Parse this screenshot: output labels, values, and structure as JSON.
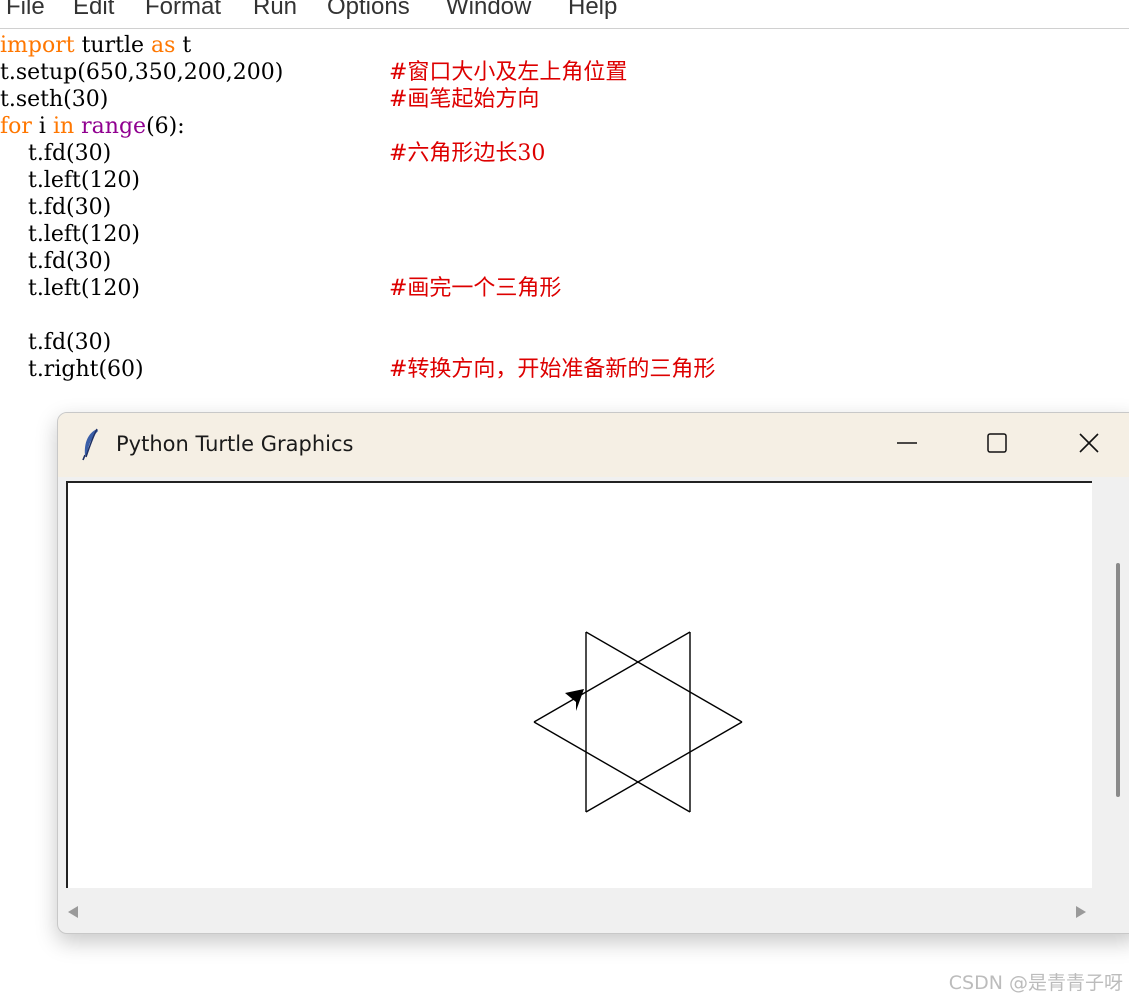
{
  "menu": [
    "File",
    "Edit",
    "Format",
    "Run",
    "Options",
    "Window",
    "Help"
  ],
  "code": [
    {
      "tokens": [
        {
          "t": "import",
          "c": "#ff7700"
        },
        {
          "t": " turtle ",
          "c": "#000000"
        },
        {
          "t": "as",
          "c": "#ff7700"
        },
        {
          "t": " t",
          "c": "#000000"
        }
      ],
      "comment": ""
    },
    {
      "tokens": [
        {
          "t": "t.setup(650,350,200,200)",
          "c": "#000000"
        }
      ],
      "comment": "#窗口大小及左上角位置"
    },
    {
      "tokens": [
        {
          "t": "t.seth(30)",
          "c": "#000000"
        }
      ],
      "comment": "#画笔起始方向"
    },
    {
      "tokens": [
        {
          "t": "for",
          "c": "#ff7700"
        },
        {
          "t": " i ",
          "c": "#000000"
        },
        {
          "t": "in",
          "c": "#ff7700"
        },
        {
          "t": " ",
          "c": "#000000"
        },
        {
          "t": "range",
          "c": "#900090"
        },
        {
          "t": "(6):",
          "c": "#000000"
        }
      ],
      "comment": ""
    },
    {
      "tokens": [
        {
          "t": "    t.fd(30)",
          "c": "#000000"
        }
      ],
      "comment": "#六角形边长30"
    },
    {
      "tokens": [
        {
          "t": "    t.left(120)",
          "c": "#000000"
        }
      ],
      "comment": ""
    },
    {
      "tokens": [
        {
          "t": "    t.fd(30)",
          "c": "#000000"
        }
      ],
      "comment": ""
    },
    {
      "tokens": [
        {
          "t": "    t.left(120)",
          "c": "#000000"
        }
      ],
      "comment": ""
    },
    {
      "tokens": [
        {
          "t": "    t.fd(30)",
          "c": "#000000"
        }
      ],
      "comment": ""
    },
    {
      "tokens": [
        {
          "t": "    t.left(120)",
          "c": "#000000"
        }
      ],
      "comment": "#画完一个三角形"
    },
    {
      "tokens": [
        {
          "t": "",
          "c": "#000000"
        }
      ],
      "comment": ""
    },
    {
      "tokens": [
        {
          "t": "    t.fd(30)",
          "c": "#000000"
        }
      ],
      "comment": ""
    },
    {
      "tokens": [
        {
          "t": "    t.right(60)",
          "c": "#000000"
        }
      ],
      "comment": "#转换方向，开始准备新的三角形"
    }
  ],
  "comment_color": "#dd0000",
  "turtle_window": {
    "title": "Python Turtle Graphics",
    "icon": "feather-icon",
    "titlebar_color": "#f5efe4"
  },
  "watermark": "CSDN @是青青子呀"
}
